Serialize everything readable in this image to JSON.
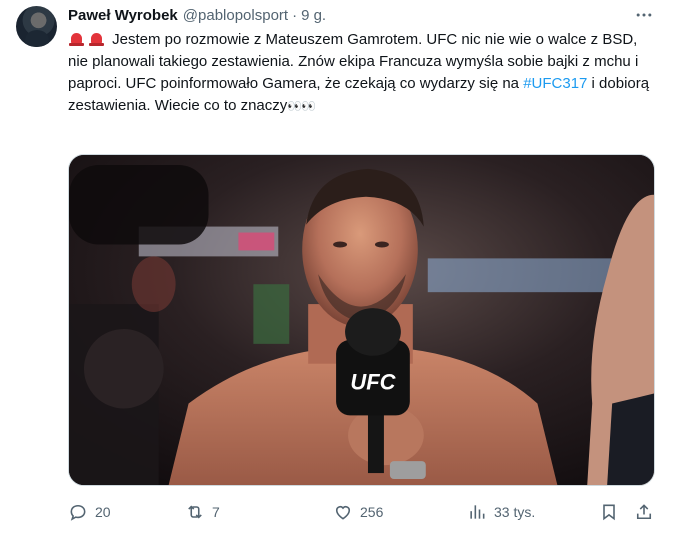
{
  "author": {
    "name": "Paweł Wyrobek",
    "handle": "@pablopolsport",
    "separator": "·",
    "time": "9 g."
  },
  "tweet": {
    "emoji_prefix": "siren-siren",
    "text_1": "Jestem po rozmowie z Mateuszem Gamrotem. UFC nic nie wie o walce z BSD, nie planowali takiego zestawienia. Znów ekipa Francuza wymyśla sobie bajki z mchu i paproci. UFC poinformowało Gamera, że czekają co wydarzy się na ",
    "hashtag": "#UFC317",
    "text_2": " i dobiorą zestawienia. Wiecie co to znaczy",
    "eyes": "👀👀"
  },
  "media": {
    "mic_logo": "UFC",
    "banner_text": "UFC"
  },
  "actions": {
    "replies": "20",
    "retweets": "7",
    "likes": "256",
    "views": "33 tys."
  },
  "icons": {
    "more": "more-horizontal-icon",
    "reply": "reply-icon",
    "retweet": "retweet-icon",
    "like": "heart-icon",
    "views": "views-icon",
    "bookmark": "bookmark-icon",
    "share": "share-icon"
  },
  "colors": {
    "text": "#0f1419",
    "secondary": "#536471",
    "link": "#1d9bf0",
    "siren": "#e3343b"
  }
}
